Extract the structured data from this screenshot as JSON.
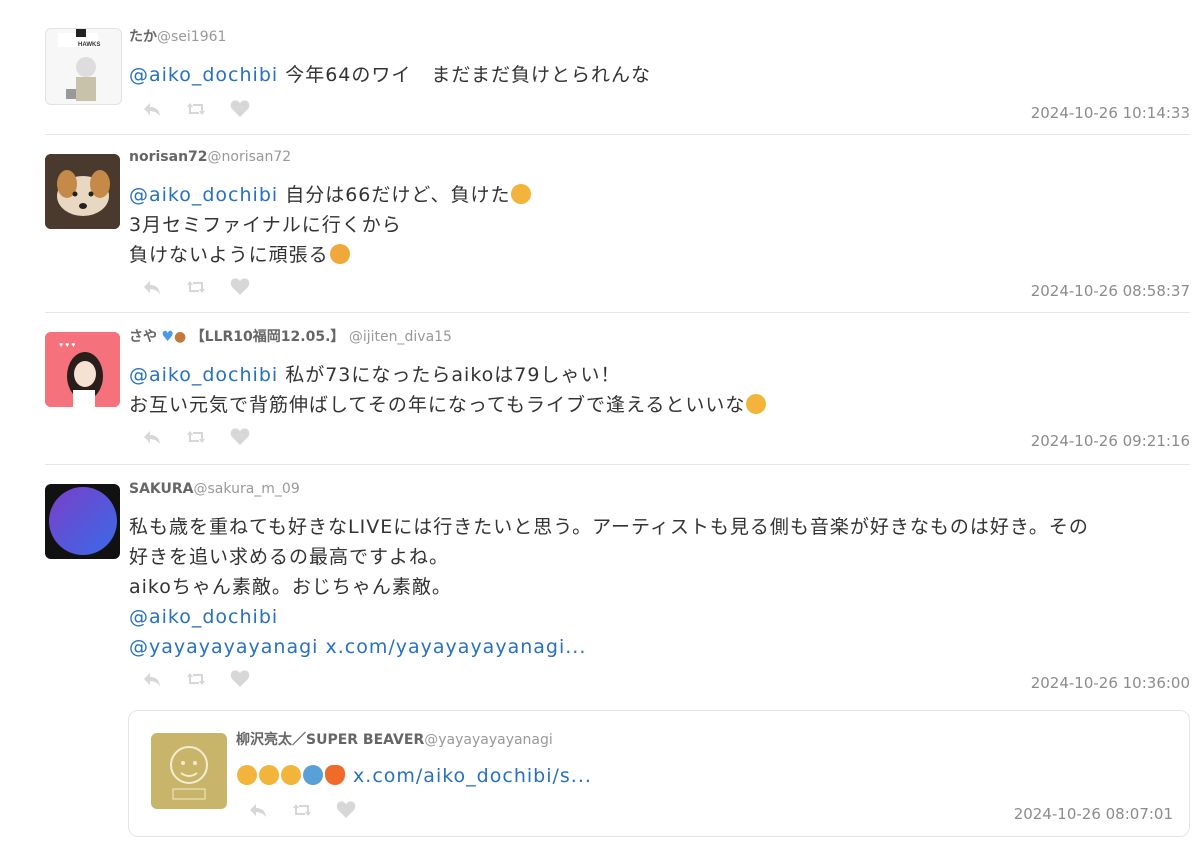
{
  "tweets": [
    {
      "name": "たか",
      "handle": "@sei1961",
      "mention": "@aiko_dochibi",
      "text": "今年64のワイ　まだまだ負けとられんな",
      "time": "2024-10-26 10:14:33"
    },
    {
      "name": "norisan72",
      "handle": "@norisan72",
      "mention": "@aiko_dochibi",
      "text1": "自分は66だけど、負けた",
      "text2": "3月セミファイナルに行くから",
      "text3": "負けないように頑張る",
      "time": "2024-10-26 08:58:37"
    },
    {
      "name": "さや",
      "badge": "【LLR10福岡12.05.】",
      "handle": "@ijiten_diva15",
      "mention": "@aiko_dochibi",
      "text1": "私が73になったらaikoは79しゃい！",
      "text2": "お互い元気で背筋伸ばしてその年になってもライブで逢えるといいな",
      "time": "2024-10-26 09:21:16"
    },
    {
      "name": "SAKURA",
      "handle": "@sakura_m_09",
      "line1": "私も歳を重ねても好きなLIVEには行きたいと思う。アーティストも見る側も音楽が好きなものは好き。その",
      "line2": "好きを追い求めるの最高ですよね。",
      "line3": "aikoちゃん素敵。おじちゃん素敵。",
      "mention": "@aiko_dochibi",
      "mention2": "@yayayayayanagi",
      "link": "x.com/yayayayayanagi...",
      "time": "2024-10-26 10:36:00"
    }
  ],
  "quote": {
    "name": "柳沢亮太／SUPER BEAVER",
    "handle": "@yayayayayanagi",
    "link": "x.com/aiko_dochibi/s...",
    "time": "2024-10-26 08:07:01"
  },
  "icons": {
    "reply": "reply-icon",
    "retweet": "retweet-icon",
    "like": "heart-icon"
  }
}
